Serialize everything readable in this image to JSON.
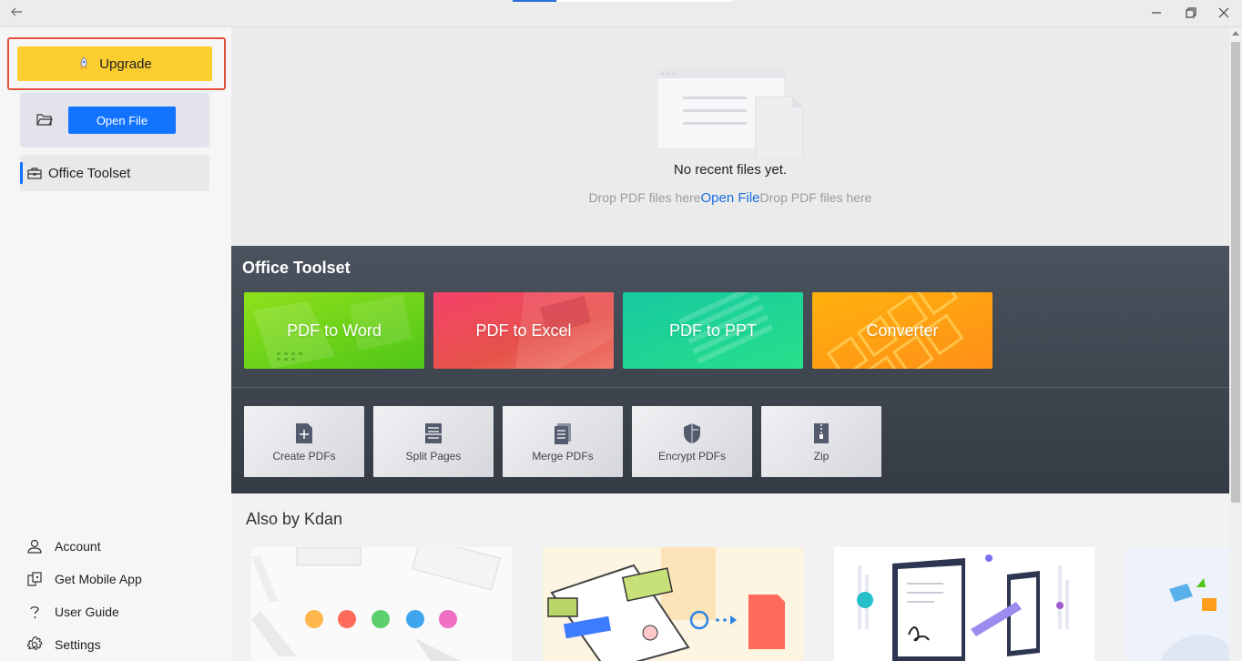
{
  "window": {
    "back_icon": "back-arrow-icon",
    "minimize": "—",
    "restore": "❐",
    "close": "✕"
  },
  "sidebar": {
    "upgrade_label": "Upgrade",
    "open_file_label": "Open File",
    "toolset_label": "Office Toolset",
    "links": [
      {
        "label": "Account",
        "icon": "user-icon"
      },
      {
        "label": "Get Mobile App",
        "icon": "mobile-icon"
      },
      {
        "label": "User Guide",
        "icon": "question-icon"
      },
      {
        "label": "Settings",
        "icon": "gear-icon"
      }
    ]
  },
  "recent": {
    "empty_text": "No recent files yet.",
    "drop_left": "Drop PDF files here",
    "open_link": "Open File",
    "drop_right": "Drop PDF files here"
  },
  "toolset": {
    "title": "Office Toolset",
    "big_tiles": [
      {
        "label": "PDF to Word",
        "color": "#5ccf1e"
      },
      {
        "label": "PDF to Excel",
        "color": "#ee3b4f"
      },
      {
        "label": "PDF to PPT",
        "color": "#1fd48a"
      },
      {
        "label": "Converter",
        "color": "#ff9f12"
      }
    ],
    "small_tiles": [
      {
        "label": "Create PDFs",
        "icon": "create-pdf-icon"
      },
      {
        "label": "Split Pages",
        "icon": "split-pages-icon"
      },
      {
        "label": "Merge PDFs",
        "icon": "merge-pdfs-icon"
      },
      {
        "label": "Encrypt PDFs",
        "icon": "shield-icon"
      },
      {
        "label": "Zip",
        "icon": "zip-icon"
      }
    ]
  },
  "also": {
    "title": "Also by Kdan"
  }
}
